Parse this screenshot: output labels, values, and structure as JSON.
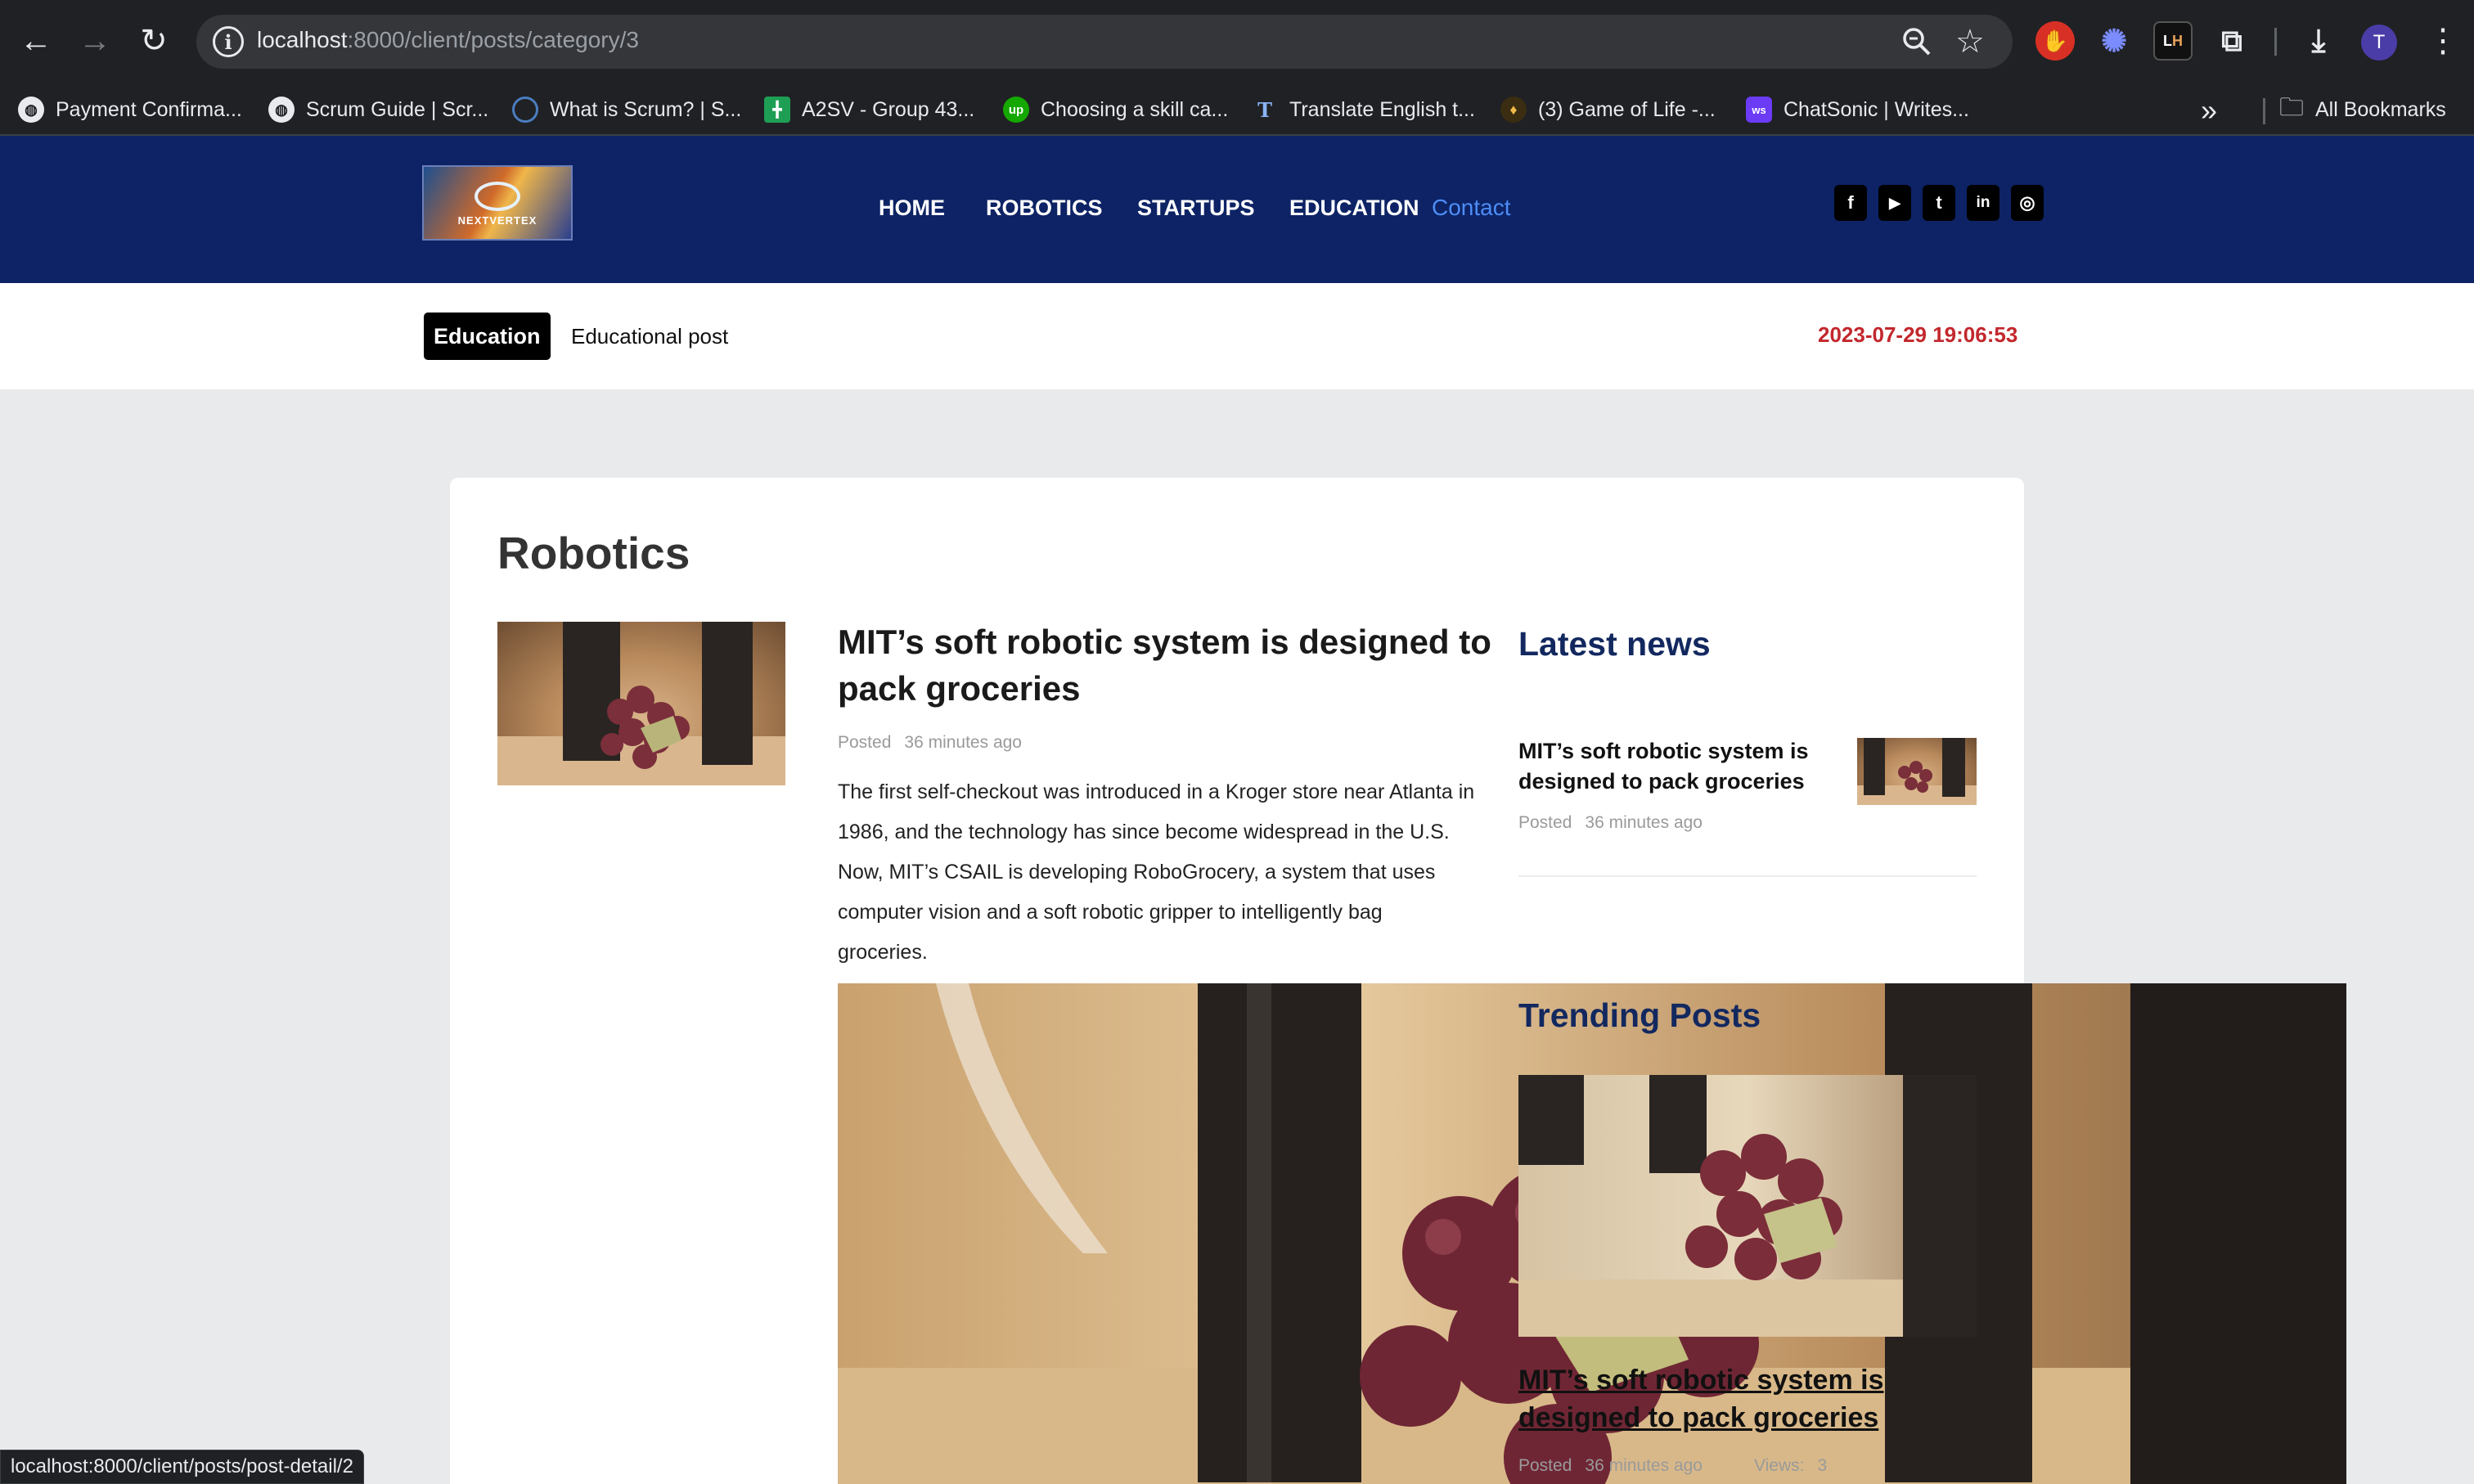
{
  "browser": {
    "url_host": "localhost",
    "url_rest": ":8000/client/posts/category/3",
    "profile_initial": "T",
    "extensions": [
      "adblock-icon",
      "sparkle-icon",
      "lighthouse-icon",
      "puzzle-icon"
    ],
    "bookmarks": [
      {
        "label": "Payment Confirma...",
        "icon": "globe-icon"
      },
      {
        "label": "Scrum Guide | Scr...",
        "icon": "globe-icon"
      },
      {
        "label": "What is Scrum? | S...",
        "icon": "scrum-icon"
      },
      {
        "label": "A2SV - Group 43...",
        "icon": "sheets-icon"
      },
      {
        "label": "Choosing a skill ca...",
        "icon": "upwork-icon"
      },
      {
        "label": "Translate English t...",
        "icon": "translate-icon"
      },
      {
        "label": "(3) Game of Life -...",
        "icon": "gameoflife-icon"
      },
      {
        "label": "ChatSonic | Writes...",
        "icon": "chatsonic-icon"
      }
    ],
    "all_bookmarks_label": "All Bookmarks",
    "status_url": "localhost:8000/client/posts/post-detail/2"
  },
  "site": {
    "logo_text": "NEXTVERTEX",
    "nav": [
      "HOME",
      "ROBOTICS",
      "STARTUPS",
      "EDUCATION"
    ],
    "nav_contact": "Contact",
    "social": [
      "facebook-icon",
      "youtube-icon",
      "twitter-icon",
      "linkedin-icon",
      "instagram-icon"
    ],
    "social_glyphs": [
      "f",
      "▶",
      "t",
      "in",
      "◎"
    ]
  },
  "ticker": {
    "badge": "Education",
    "text": "Educational post",
    "datetime": "2023-07-29 19:06:53"
  },
  "category": {
    "title": "Robotics"
  },
  "post": {
    "title": "MIT’s soft robotic system is designed to pack groceries",
    "posted_label": "Posted",
    "posted_time": "36 minutes ago",
    "excerpt": "The first self-checkout was introduced in a Kroger store near Atlanta in 1986, and the technology has since become widespread in the U.S. Now, MIT’s CSAIL is developing RoboGrocery, a system that uses computer vision and a soft robotic gripper to intelligently bag groceries."
  },
  "latest": {
    "heading": "Latest news",
    "item_title": "MIT’s soft robotic system is designed to pack groceries",
    "posted_label": "Posted",
    "posted_time": "36 minutes ago"
  },
  "trending": {
    "heading": "Trending Posts",
    "item_title": "MIT’s soft robotic system is designed to pack groceries",
    "posted_label": "Posted",
    "posted_time": "36 minutes ago",
    "views_label": "Views:",
    "views_count": "3"
  },
  "colors": {
    "header_bg": "#0d2365",
    "contact_link": "#4d8df7",
    "date_red": "#c2272d",
    "side_heading": "#12285f"
  }
}
